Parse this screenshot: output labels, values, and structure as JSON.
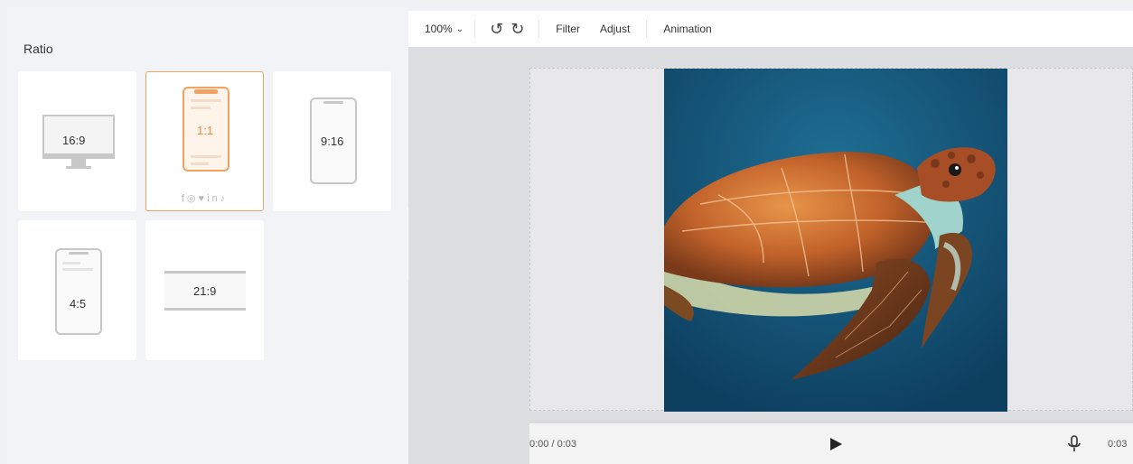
{
  "panel": {
    "title": "Ratio",
    "cards": [
      {
        "label": "16:9",
        "selected": false
      },
      {
        "label": "1:1",
        "selected": true
      },
      {
        "label": "9:16",
        "selected": false
      },
      {
        "label": "4:5",
        "selected": false
      },
      {
        "label": "21:9",
        "selected": false
      }
    ],
    "social_icons": [
      "facebook-icon",
      "instagram-icon",
      "twitter-icon",
      "linkedin-icon",
      "tiktok-icon"
    ]
  },
  "toolbar": {
    "zoom": "100%",
    "undo_icon": "undo-icon",
    "redo_icon": "redo-icon",
    "filter_label": "Filter",
    "adjust_label": "Adjust",
    "animation_label": "Animation"
  },
  "player": {
    "current_display": "0:00 / 0:03",
    "total": "0:03",
    "progress": 0
  },
  "colors": {
    "accent": "#f08a3a",
    "accent_light": "#fff4ea",
    "panel_bg": "#f2f3f6",
    "canvas_bg": "#dcdee1",
    "ocean_dark": "#0d3f5f",
    "ocean_light": "#1f6f95"
  }
}
